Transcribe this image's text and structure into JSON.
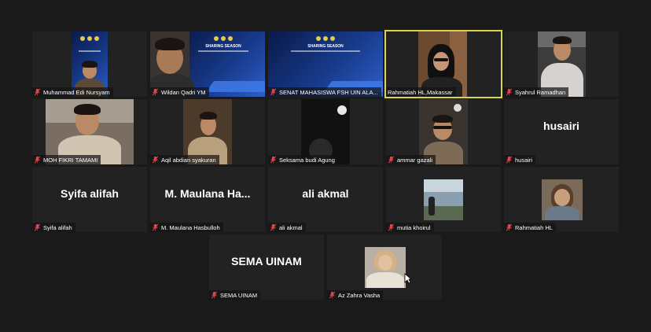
{
  "participants": [
    {
      "name": "Muhammad Edi Nursyam",
      "display": "",
      "muted": true
    },
    {
      "name": "Wildan Qadri YM",
      "display": "",
      "muted": true
    },
    {
      "name": "SENAT MAHASISWA FSH UIN ALA...",
      "display": "",
      "muted": true
    },
    {
      "name": "Rahmatiah HL,Makassar",
      "display": "",
      "muted": false,
      "active_speaker": true
    },
    {
      "name": "Syahrul Ramadhan",
      "display": "",
      "muted": true
    },
    {
      "name": "MOH FIKRI TAMAMI",
      "display": "",
      "muted": true
    },
    {
      "name": "Aqil abdian syakuran",
      "display": "",
      "muted": true
    },
    {
      "name": "Seksama budi Agung",
      "display": "",
      "muted": true
    },
    {
      "name": "ammar gazali",
      "display": "",
      "muted": true
    },
    {
      "name": "husairi",
      "display": "husairi",
      "muted": true
    },
    {
      "name": "Syifa alifah",
      "display": "Syifa alifah",
      "muted": true
    },
    {
      "name": "M. Maulana Hasbulloh",
      "display": "M. Maulana Ha...",
      "muted": true
    },
    {
      "name": "ali akmal",
      "display": "ali akmal",
      "muted": true
    },
    {
      "name": "mutia khoirul",
      "display": "",
      "muted": true
    },
    {
      "name": "Rahmatiah HL",
      "display": "",
      "muted": true
    },
    {
      "name": "SEMA UINAM",
      "display": "SEMA UINAM",
      "muted": true
    },
    {
      "name": "Az Zahra Vasha",
      "display": "",
      "muted": true
    }
  ],
  "slide": {
    "title": "SHARING SEASON"
  },
  "colors": {
    "background": "#1a1a1a",
    "tile": "#222222",
    "active_border": "#d8d54a",
    "muted_mic": "#e0474c"
  },
  "icons": {
    "muted": "mic-off-icon",
    "cursor": "mouse-cursor-icon"
  }
}
